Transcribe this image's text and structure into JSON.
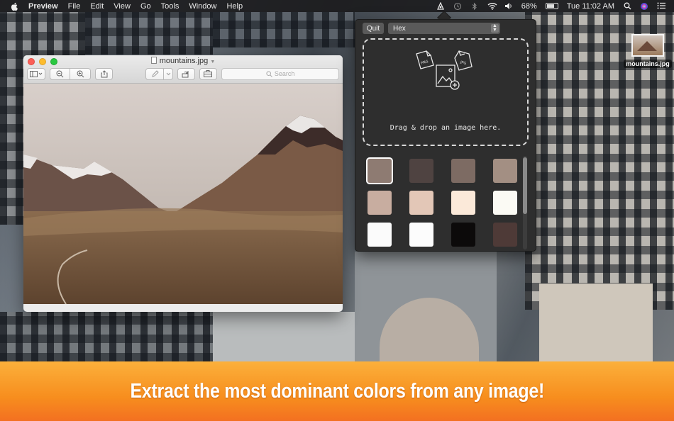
{
  "menubar": {
    "app_name": "Preview",
    "menus": [
      "File",
      "Edit",
      "View",
      "Go",
      "Tools",
      "Window",
      "Help"
    ],
    "battery": "68%",
    "clock": "Tue 11:02 AM"
  },
  "preview_window": {
    "title": "mountains.jpg",
    "search_placeholder": "Search"
  },
  "popover": {
    "quit_label": "Quit",
    "format_selected": "Hex",
    "dropzone_text": "Drag & drop an image here.",
    "icon_labels": [
      "PNG",
      "JPG"
    ],
    "swatches": [
      "#8e7b72",
      "#4f4341",
      "#7d6b63",
      "#a38f83",
      "#c8ada0",
      "#e3c7b7",
      "#fbe9d9",
      "#fbfaf4",
      "#fbfbfb",
      "#fcfcfc",
      "#0c0a0a",
      "#4e3a37"
    ],
    "selected_swatch_index": 0
  },
  "desktop_file": {
    "label": "mountains.jpg"
  },
  "banner": {
    "text": "Extract the most dominant colors from any image!",
    "colors": [
      "#fbb03b",
      "#f37021"
    ]
  }
}
